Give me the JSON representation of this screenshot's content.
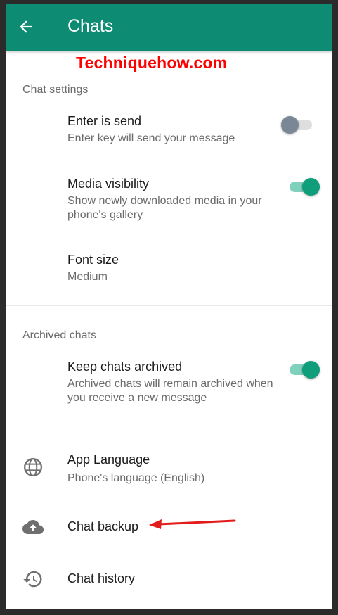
{
  "appbar": {
    "title": "Chats",
    "back_icon": "arrow-back-icon"
  },
  "watermark": "Techniquehow.com",
  "chat_settings": {
    "header": "Chat settings",
    "enter_is_send": {
      "title": "Enter is send",
      "subtitle": "Enter key will send your message",
      "enabled": false
    },
    "media_visibility": {
      "title": "Media visibility",
      "subtitle": "Show newly downloaded media in your phone's gallery",
      "enabled": true
    },
    "font_size": {
      "title": "Font size",
      "value": "Medium"
    }
  },
  "archived_chats": {
    "header": "Archived chats",
    "keep_archived": {
      "title": "Keep chats archived",
      "subtitle": "Archived chats will remain archived when you receive a new message",
      "enabled": true
    }
  },
  "other": {
    "app_language": {
      "title": "App Language",
      "subtitle": "Phone's language (English)",
      "icon": "globe-icon"
    },
    "chat_backup": {
      "title": "Chat backup",
      "icon": "cloud-upload-icon"
    },
    "chat_history": {
      "title": "Chat history",
      "icon": "history-icon"
    }
  },
  "colors": {
    "appbar": "#0d8b73",
    "switch_on": "#0f9d7a",
    "switch_off": "#7a8794",
    "watermark": "#ff0000",
    "annotation_arrow": "#e31b1b"
  }
}
